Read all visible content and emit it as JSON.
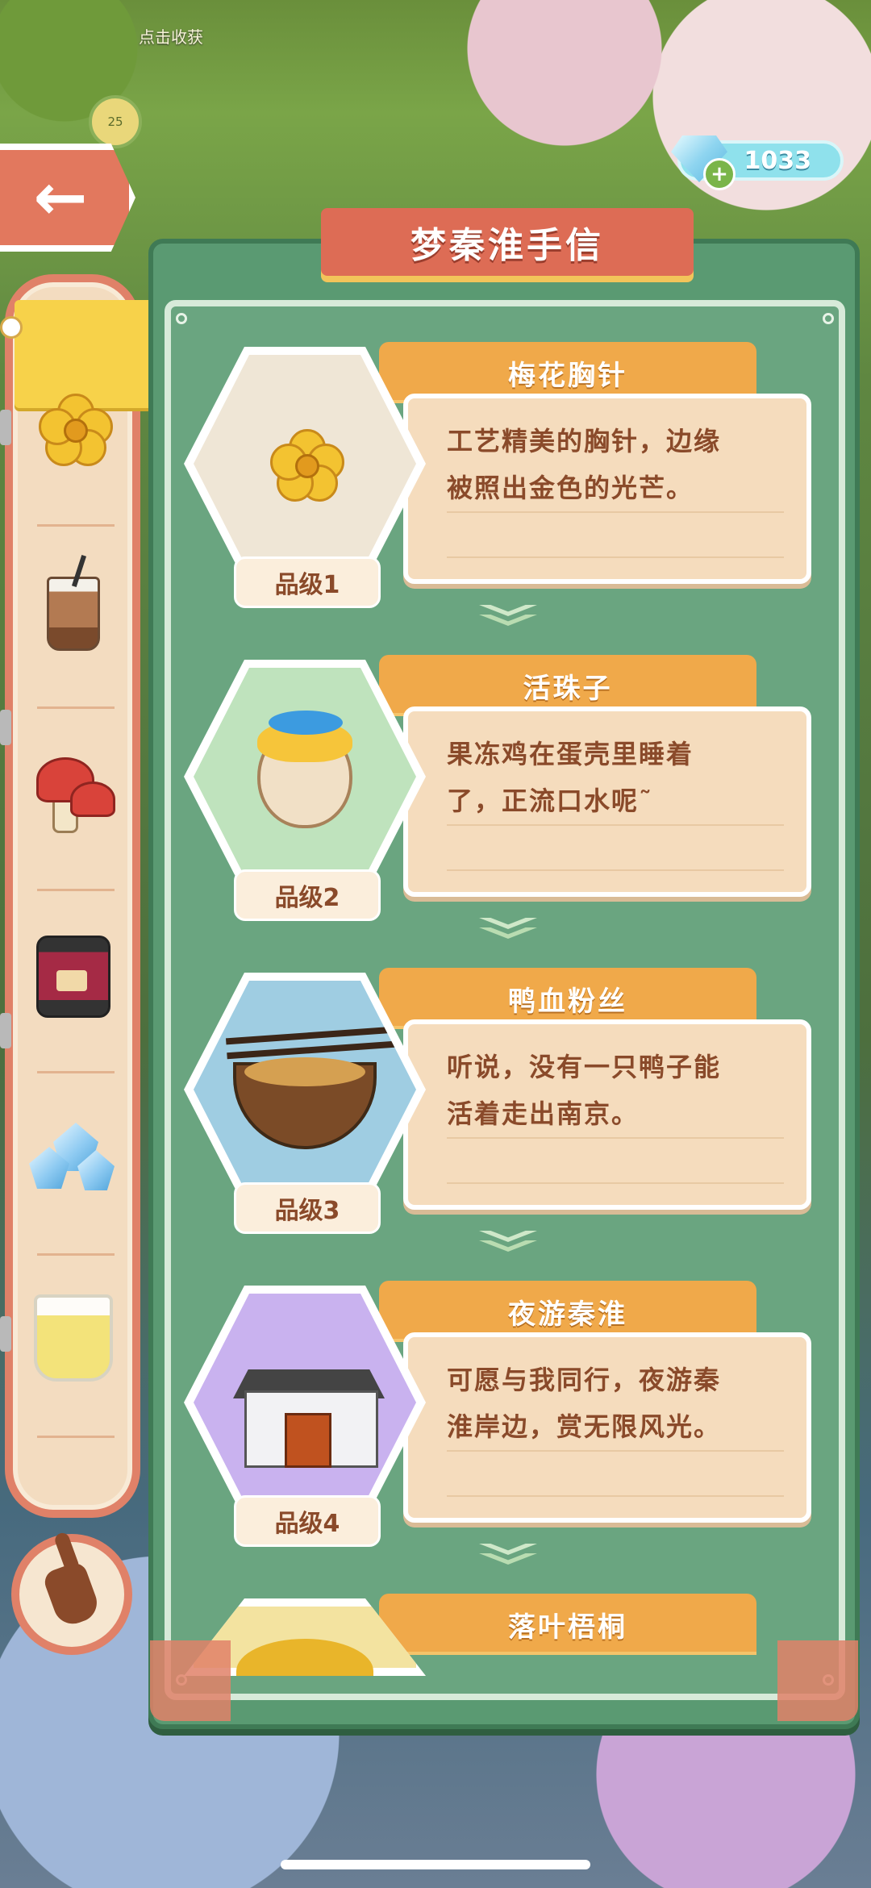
{
  "hud": {
    "top_hint": "点击收获",
    "level_badge": "25",
    "currency_value": "1033",
    "currency_icon": "diamond-gem-icon",
    "back_icon": "arrow-left-icon"
  },
  "panel": {
    "title": "梦秦淮手信"
  },
  "sidebar": {
    "items": [
      {
        "icon": "plum-blossom-brooch-icon",
        "active": true
      },
      {
        "icon": "iced-coffee-icon",
        "active": false
      },
      {
        "icon": "red-mushroom-icon",
        "active": false
      },
      {
        "icon": "pressure-cooker-icon",
        "active": false
      },
      {
        "icon": "crystal-cluster-icon",
        "active": false
      },
      {
        "icon": "tea-cup-icon",
        "active": false
      }
    ]
  },
  "cards": [
    {
      "name": "梅花胸针",
      "desc_line1": "工艺精美的胸针，边缘",
      "desc_line2": "被照出金色的光芒。",
      "grade": "品级1",
      "art": "plum-blossom-brooch-icon",
      "bg": "#efe6d6"
    },
    {
      "name": "活珠子",
      "desc_line1": "果冻鸡在蛋壳里睡着",
      "desc_line2": "了，正流口水呢˜",
      "grade": "品级2",
      "art": "sleeping-chick-egg-icon",
      "bg": "#bfe3bd"
    },
    {
      "name": "鸭血粉丝",
      "desc_line1": "听说，没有一只鸭子能",
      "desc_line2": "活着走出南京。",
      "grade": "品级3",
      "art": "duck-blood-noodle-bowl-icon",
      "bg": "#9fcde2"
    },
    {
      "name": "夜游秦淮",
      "desc_line1": "可愿与我同行，夜游秦",
      "desc_line2": "淮岸边，赏无限风光。",
      "grade": "品级4",
      "art": "qinhuai-house-icon",
      "bg": "#c9b2ef"
    },
    {
      "name": "落叶梧桐",
      "desc_line1": "",
      "desc_line2": "",
      "grade": "",
      "art": "golden-plane-tree-icon",
      "bg": "#f3e3a0"
    }
  ],
  "colors": {
    "panel_green": "#5a9a72",
    "accent_orange": "#f0a94a",
    "title_red": "#dd6c55",
    "card_cream": "#f5dcbd",
    "text_brown": "#8a4a2a"
  }
}
